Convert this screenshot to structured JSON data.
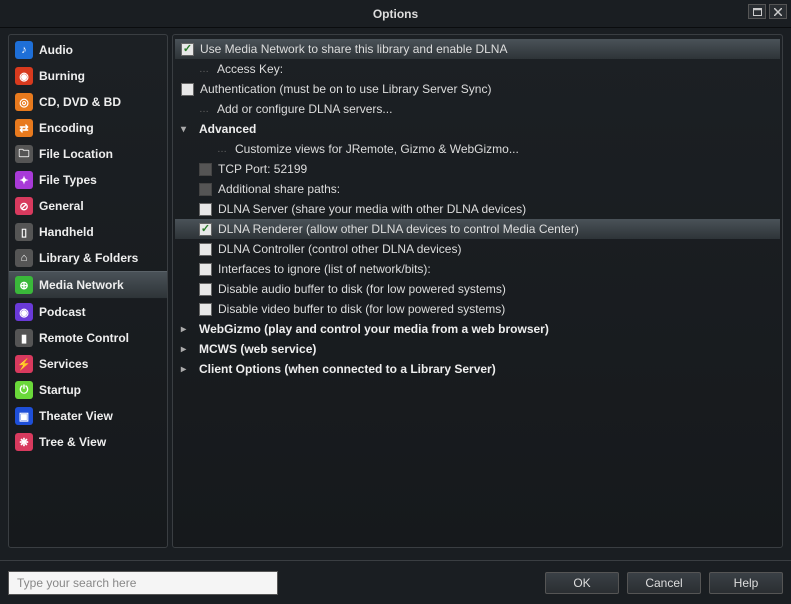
{
  "title": "Options",
  "sidebar": {
    "items": [
      {
        "label": "Audio",
        "icon": "♪",
        "bg": "#1e6fd8"
      },
      {
        "label": "Burning",
        "icon": "◉",
        "bg": "#d83a1e"
      },
      {
        "label": "CD, DVD & BD",
        "icon": "◎",
        "bg": "#e87a1e"
      },
      {
        "label": "Encoding",
        "icon": "⇄",
        "bg": "#e87a1e"
      },
      {
        "label": "File Location",
        "icon": "🗀",
        "bg": "#555"
      },
      {
        "label": "File Types",
        "icon": "✦",
        "bg": "#a83ad8"
      },
      {
        "label": "General",
        "icon": "⊘",
        "bg": "#d83a5e"
      },
      {
        "label": "Handheld",
        "icon": "▯",
        "bg": "#555"
      },
      {
        "label": "Library & Folders",
        "icon": "⌂",
        "bg": "#555"
      },
      {
        "label": "Media Network",
        "icon": "⊕",
        "bg": "#3ab83a"
      },
      {
        "label": "Podcast",
        "icon": "◉",
        "bg": "#6a3ad8"
      },
      {
        "label": "Remote Control",
        "icon": "▮",
        "bg": "#555"
      },
      {
        "label": "Services",
        "icon": "⚡",
        "bg": "#d83a5e"
      },
      {
        "label": "Startup",
        "icon": "⏻",
        "bg": "#6ad83a"
      },
      {
        "label": "Theater View",
        "icon": "▣",
        "bg": "#1e4fd8"
      },
      {
        "label": "Tree & View",
        "icon": "❋",
        "bg": "#d83a5e"
      }
    ],
    "selected_index": 9
  },
  "content": {
    "rows": [
      {
        "type": "check",
        "checked": true,
        "label": "Use Media Network to share this library and enable DLNA",
        "indent": 0,
        "highlighted": true
      },
      {
        "type": "text",
        "label": "Access Key:",
        "indent": 1,
        "dots": true
      },
      {
        "type": "check",
        "checked": false,
        "label": "Authentication (must be on to use Library Server Sync)",
        "indent": 0
      },
      {
        "type": "text",
        "label": "Add or configure DLNA servers...",
        "indent": 1,
        "dots": true
      },
      {
        "type": "heading",
        "label": "Advanced",
        "indent": 0,
        "arrow": "down"
      },
      {
        "type": "text",
        "label": "Customize views for JRemote, Gizmo & WebGizmo...",
        "indent": 2,
        "dots": true
      },
      {
        "type": "dimcheck",
        "label": "TCP Port: 52199",
        "indent": 1
      },
      {
        "type": "dimcheck",
        "label": "Additional share paths:",
        "indent": 1
      },
      {
        "type": "check",
        "checked": false,
        "label": "DLNA Server (share your media with other DLNA devices)",
        "indent": 1
      },
      {
        "type": "check",
        "checked": true,
        "label": "DLNA Renderer (allow other DLNA devices to control Media Center)",
        "indent": 1,
        "highlighted": true
      },
      {
        "type": "check",
        "checked": false,
        "label": "DLNA Controller (control other DLNA devices)",
        "indent": 1
      },
      {
        "type": "check",
        "checked": false,
        "label": "Interfaces to ignore (list of network/bits):",
        "indent": 1
      },
      {
        "type": "check",
        "checked": false,
        "label": "Disable audio buffer to disk (for low powered systems)",
        "indent": 1
      },
      {
        "type": "check",
        "checked": false,
        "label": "Disable video buffer to disk (for low powered systems)",
        "indent": 1
      },
      {
        "type": "heading",
        "label": "WebGizmo (play and control your media from a web browser)",
        "indent": 0,
        "arrow": "right"
      },
      {
        "type": "heading",
        "label": "MCWS (web service)",
        "indent": 0,
        "arrow": "right"
      },
      {
        "type": "heading",
        "label": "Client Options (when connected to a Library Server)",
        "indent": 0,
        "arrow": "right"
      }
    ]
  },
  "footer": {
    "search_placeholder": "Type your search here",
    "ok": "OK",
    "cancel": "Cancel",
    "help": "Help"
  }
}
